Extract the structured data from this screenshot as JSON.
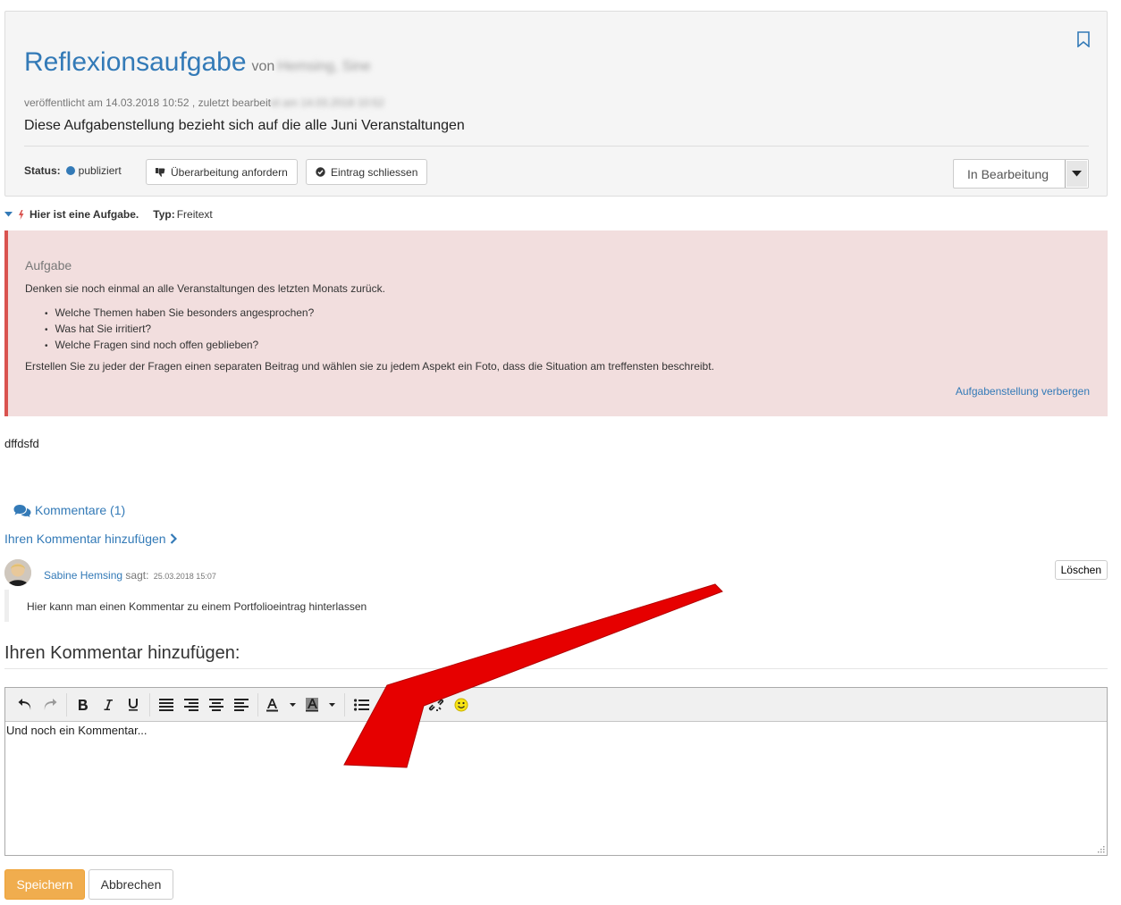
{
  "entry": {
    "title": "Reflexionsaufgabe",
    "by": "von",
    "author_redacted": "Hemsing, Sine",
    "meta_published": "veröffentlicht am 14.03.2018 10:52 , zuletzt bearbeit",
    "meta_edited_redacted": "et am 14.03.2018 10:52",
    "description": "Diese Aufgabenstellung bezieht sich auf die alle Juni Veranstaltungen"
  },
  "status": {
    "label": "Status:",
    "value": "publiziert",
    "request_revision_label": "Überarbeitung anfordern",
    "close_entry_label": "Eintrag schliessen",
    "state_value": "In Bearbeitung"
  },
  "task": {
    "title": "Hier ist eine Aufgabe.",
    "type_label": "Typ:",
    "type_value": "Freitext"
  },
  "assignment": {
    "heading": "Aufgabe",
    "intro": "Denken sie noch einmal an alle Veranstaltungen des letzten Monats zurück.",
    "bullets": [
      "Welche Themen haben Sie besonders angesprochen?",
      "Was hat Sie irritiert?",
      "Welche Fragen sind noch offen geblieben?"
    ],
    "outro": "Erstellen Sie zu jeder der Fragen einen separaten Beitrag und wählen sie zu jedem Aspekt ein Foto, dass die Situation am treffensten beschreibt.",
    "hide_link": "Aufgabenstellung verbergen"
  },
  "entry_body": "dffdsfd",
  "comments": {
    "toggle_label": "Kommentare (1)",
    "add_link": "Ihren Kommentar hinzufügen",
    "items": [
      {
        "author": "Sabine Hemsing",
        "says": "sagt:",
        "date": "25.03.2018 15:07",
        "text": "Hier kann man einen Kommentar zu einem Portfolioeintrag hinterlassen",
        "delete_label": "Löschen"
      }
    ]
  },
  "form": {
    "heading": "Ihren Kommentar hinzufügen:",
    "editor_value": "Und noch ein Kommentar...",
    "save_label": "Speichern",
    "cancel_label": "Abbrechen"
  },
  "colors": {
    "accent": "#337ab7",
    "alert_bg": "#f2dede",
    "alert_border": "#d9534f",
    "save_button": "#f0ad4e",
    "annotation_arrow": "#e60000"
  },
  "icons": [
    "bookmark-icon",
    "thumbs-down-icon",
    "check-circle-icon",
    "caret-down-icon",
    "lightning-icon",
    "comments-icon",
    "chevron-right-icon",
    "undo-icon",
    "redo-icon",
    "bold-icon",
    "italic-icon",
    "underline-icon",
    "align-justify-icon",
    "align-right-icon",
    "align-center-icon",
    "align-left-icon",
    "text-color-icon",
    "background-color-icon",
    "bullet-list-icon",
    "numbered-list-icon",
    "link-icon",
    "unlink-icon",
    "emoticon-icon"
  ]
}
